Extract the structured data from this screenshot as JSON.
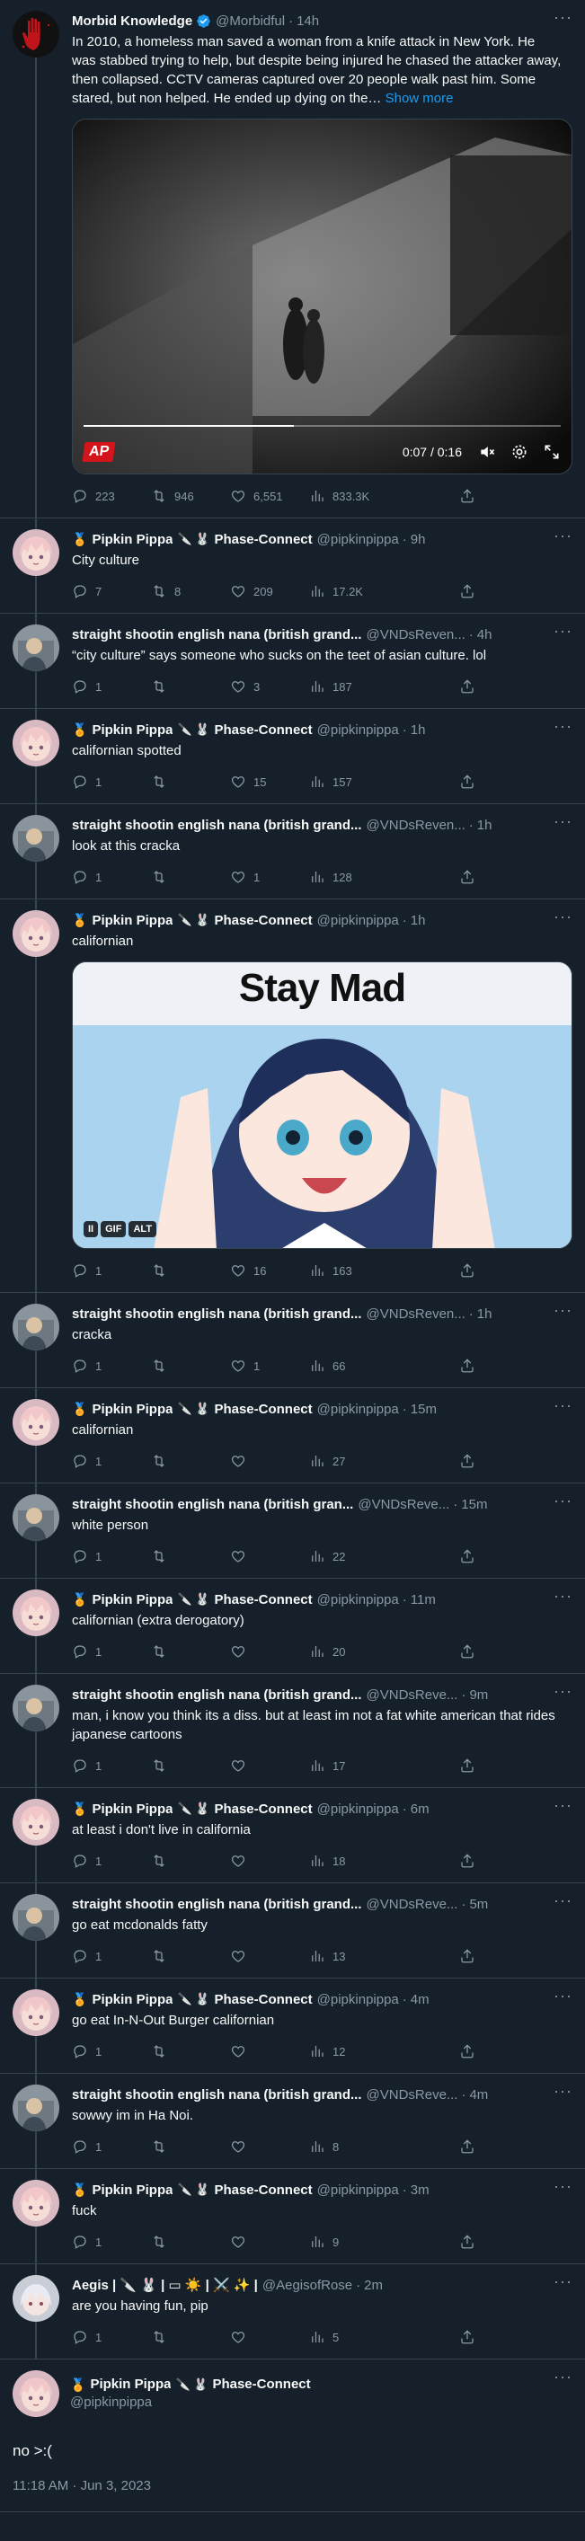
{
  "colors": {
    "background": "#15202b",
    "accent": "#1d9bf0",
    "muted": "#8b98a5",
    "border": "#38444d"
  },
  "tweets": [
    {
      "name": "Morbid Knowledge",
      "verified": true,
      "handle": "@Morbidful",
      "time": "14h",
      "text": "In 2010, a homeless man saved a woman from a knife attack in New York. He was stabbed trying to help, but despite being injured he chased the attacker away, then collapsed. CCTV cameras captured over 20 people walk past him. Some stared, but non helped. He ended up dying on the…",
      "show_more": "Show more",
      "video": {
        "logo": "AP",
        "time": "0:07 / 0:16",
        "progress": 0.44
      },
      "replies": "223",
      "retweets": "946",
      "likes": "6,551",
      "views": "833.3K"
    },
    {
      "name": "Pipkin Pippa",
      "medal": "🏅",
      "extra": "Phase-Connect",
      "handle": "@pipkinpippa",
      "time": "9h",
      "text": "City culture",
      "replies": "7",
      "retweets": "8",
      "likes": "209",
      "views": "17.2K"
    },
    {
      "name": "straight shootin english nana (british grand...",
      "handle": "@VNDsReven...",
      "time": "4h",
      "text": "“city culture” says someone who sucks on the teet of asian culture. lol",
      "replies": "1",
      "retweets": "",
      "likes": "3",
      "views": "187"
    },
    {
      "name": "Pipkin Pippa",
      "medal": "🏅",
      "extra": "Phase-Connect",
      "handle": "@pipkinpippa",
      "time": "1h",
      "text": "californian spotted",
      "replies": "1",
      "retweets": "",
      "likes": "15",
      "views": "157"
    },
    {
      "name": "straight shootin english nana (british grand...",
      "handle": "@VNDsReven...",
      "time": "1h",
      "text": "look at this cracka",
      "replies": "1",
      "retweets": "",
      "likes": "1",
      "views": "128"
    },
    {
      "name": "Pipkin Pippa",
      "medal": "🏅",
      "extra": "Phase-Connect",
      "handle": "@pipkinpippa",
      "time": "1h",
      "text": "californian",
      "gif": {
        "caption": "Stay Mad",
        "badges": [
          "II",
          "GIF",
          "ALT"
        ]
      },
      "replies": "1",
      "retweets": "",
      "likes": "16",
      "views": "163"
    },
    {
      "name": "straight shootin english nana (british grand...",
      "handle": "@VNDsReven...",
      "time": "1h",
      "text": "cracka",
      "replies": "1",
      "retweets": "",
      "likes": "1",
      "views": "66"
    },
    {
      "name": "Pipkin Pippa",
      "medal": "🏅",
      "extra": "Phase-Connect",
      "handle": "@pipkinpippa",
      "time": "15m",
      "text": "californian",
      "replies": "1",
      "retweets": "",
      "likes": "",
      "views": "27"
    },
    {
      "name": "straight shootin english nana (british gran...",
      "handle": "@VNDsReve...",
      "time": "15m",
      "text": "white person",
      "replies": "1",
      "retweets": "",
      "likes": "",
      "views": "22"
    },
    {
      "name": "Pipkin Pippa",
      "medal": "🏅",
      "extra": "Phase-Connect",
      "handle": "@pipkinpippa",
      "time": "11m",
      "text": "californian (extra derogatory)",
      "replies": "1",
      "retweets": "",
      "likes": "",
      "views": "20"
    },
    {
      "name": "straight shootin english nana (british grand...",
      "handle": "@VNDsReve...",
      "time": "9m",
      "text": "man, i know you think its a diss. but at least im not a fat white american that rides japanese cartoons",
      "replies": "1",
      "retweets": "",
      "likes": "",
      "views": "17"
    },
    {
      "name": "Pipkin Pippa",
      "medal": "🏅",
      "extra": "Phase-Connect",
      "handle": "@pipkinpippa",
      "time": "6m",
      "text": "at least i don't live in california",
      "replies": "1",
      "retweets": "",
      "likes": "",
      "views": "18"
    },
    {
      "name": "straight shootin english nana (british grand...",
      "handle": "@VNDsReve...",
      "time": "5m",
      "text": "go eat mcdonalds fatty",
      "replies": "1",
      "retweets": "",
      "likes": "",
      "views": "13"
    },
    {
      "name": "Pipkin Pippa",
      "medal": "🏅",
      "extra": "Phase-Connect",
      "handle": "@pipkinpippa",
      "time": "4m",
      "text": "go eat In-N-Out Burger californian",
      "replies": "1",
      "retweets": "",
      "likes": "",
      "views": "12"
    },
    {
      "name": "straight shootin english nana (british grand...",
      "handle": "@VNDsReve...",
      "time": "4m",
      "text": "sowwy im in Ha Noi.",
      "replies": "1",
      "retweets": "",
      "likes": "",
      "views": "8"
    },
    {
      "name": "Pipkin Pippa",
      "medal": "🏅",
      "extra": "Phase-Connect",
      "handle": "@pipkinpippa",
      "time": "3m",
      "text": "fuck",
      "replies": "1",
      "retweets": "",
      "likes": "",
      "views": "9"
    },
    {
      "name": "Aegis | 🔪 🐰 | ▭ ☀️ | ⚔️ ✨ |",
      "handle": "@AegisofRose",
      "time": "2m",
      "text": "are you having fun, pip",
      "replies": "1",
      "retweets": "",
      "likes": "",
      "views": "5"
    }
  ],
  "focal": {
    "name": "Pipkin Pippa",
    "medal": "🏅",
    "extra": "Phase-Connect",
    "handle": "@pipkinpippa",
    "text": "no >:(",
    "timestamp": "11:18 AM · Jun 3, 2023"
  }
}
